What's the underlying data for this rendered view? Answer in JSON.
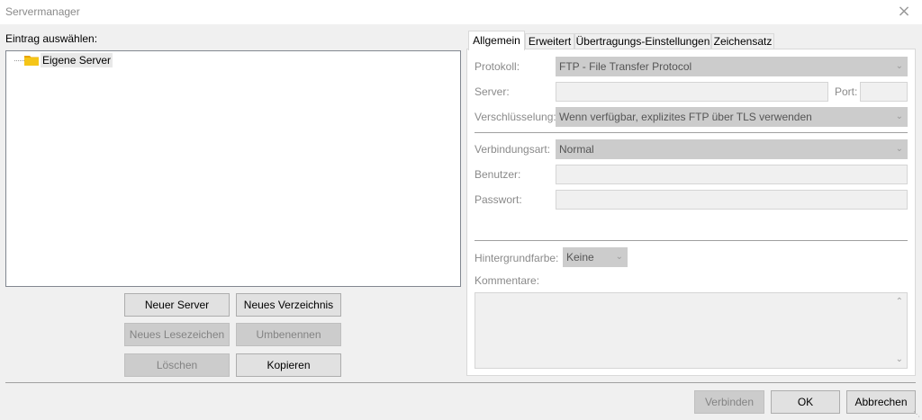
{
  "window": {
    "title": "Servermanager",
    "close_icon": "×"
  },
  "left": {
    "select_label": "Eintrag auswählen:",
    "tree": {
      "items": [
        {
          "label": "Eigene Server",
          "icon": "folder-icon",
          "selected": true
        }
      ]
    },
    "buttons": {
      "new_server": "Neuer Server",
      "new_folder": "Neues Verzeichnis",
      "new_bookmark": "Neues Lesezeichen",
      "rename": "Umbenennen",
      "delete": "Löschen",
      "copy": "Kopieren"
    }
  },
  "tabs": [
    {
      "label": "Allgemein",
      "active": true
    },
    {
      "label": "Erweitert",
      "active": false
    },
    {
      "label": "Übertragungs-Einstellungen",
      "active": false
    },
    {
      "label": "Zeichensatz",
      "active": false
    }
  ],
  "general": {
    "protocol_label": "Protokoll:",
    "protocol_value": "FTP - File Transfer Protocol",
    "server_label": "Server:",
    "server_value": "",
    "port_label": "Port:",
    "port_value": "",
    "encryption_label": "Verschlüsselung:",
    "encryption_value": "Wenn verfügbar, explizites FTP über TLS verwenden",
    "logon_type_label": "Verbindungsart:",
    "logon_type_value": "Normal",
    "user_label": "Benutzer:",
    "user_value": "",
    "password_label": "Passwort:",
    "password_value": "",
    "background_label": "Hintergrundfarbe:",
    "background_value": "Keine",
    "comments_label": "Kommentare:",
    "comments_value": ""
  },
  "footer": {
    "connect": "Verbinden",
    "ok": "OK",
    "cancel": "Abbrechen"
  },
  "colors": {
    "folder": "#f5c518",
    "disabled_bg": "#cccccc",
    "button_bg": "#e1e1e1"
  }
}
